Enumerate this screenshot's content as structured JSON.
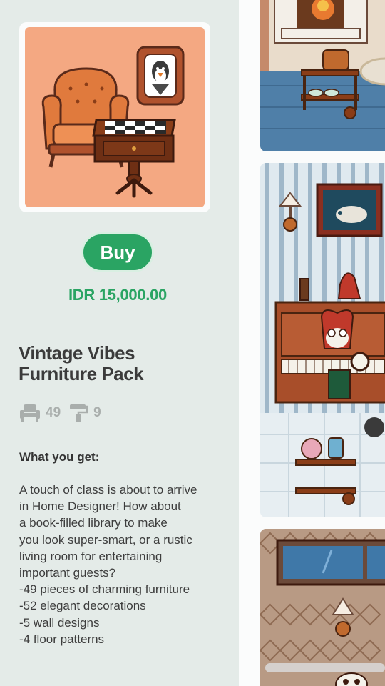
{
  "product": {
    "buy_label": "Buy",
    "price": "IDR 15,000.00",
    "title_line1": "Vintage Vibes",
    "title_line2": "Furniture Pack",
    "furniture_count": "49",
    "decoration_count": "9",
    "what_you_get_title": "What you get:",
    "description_lines": [
      "A touch of class is about to arrive",
      "in Home Designer! How about",
      "a book-filled library to make",
      "you look super-smart, or a rustic",
      "living room for entertaining",
      "important guests?",
      "-49 pieces of charming furniture",
      "-52 elegant decorations",
      "-5 wall designs",
      "-4 floor patterns"
    ]
  },
  "icons": {
    "furniture": "armchair-icon",
    "decoration": "paint-roller-icon"
  },
  "colors": {
    "accent_green": "#2aa463",
    "thumbnail_bg": "#f4a882",
    "panel_bg": "#e4ebe8",
    "title_text": "#3b3b3b",
    "muted_icon": "#a9aeac"
  }
}
